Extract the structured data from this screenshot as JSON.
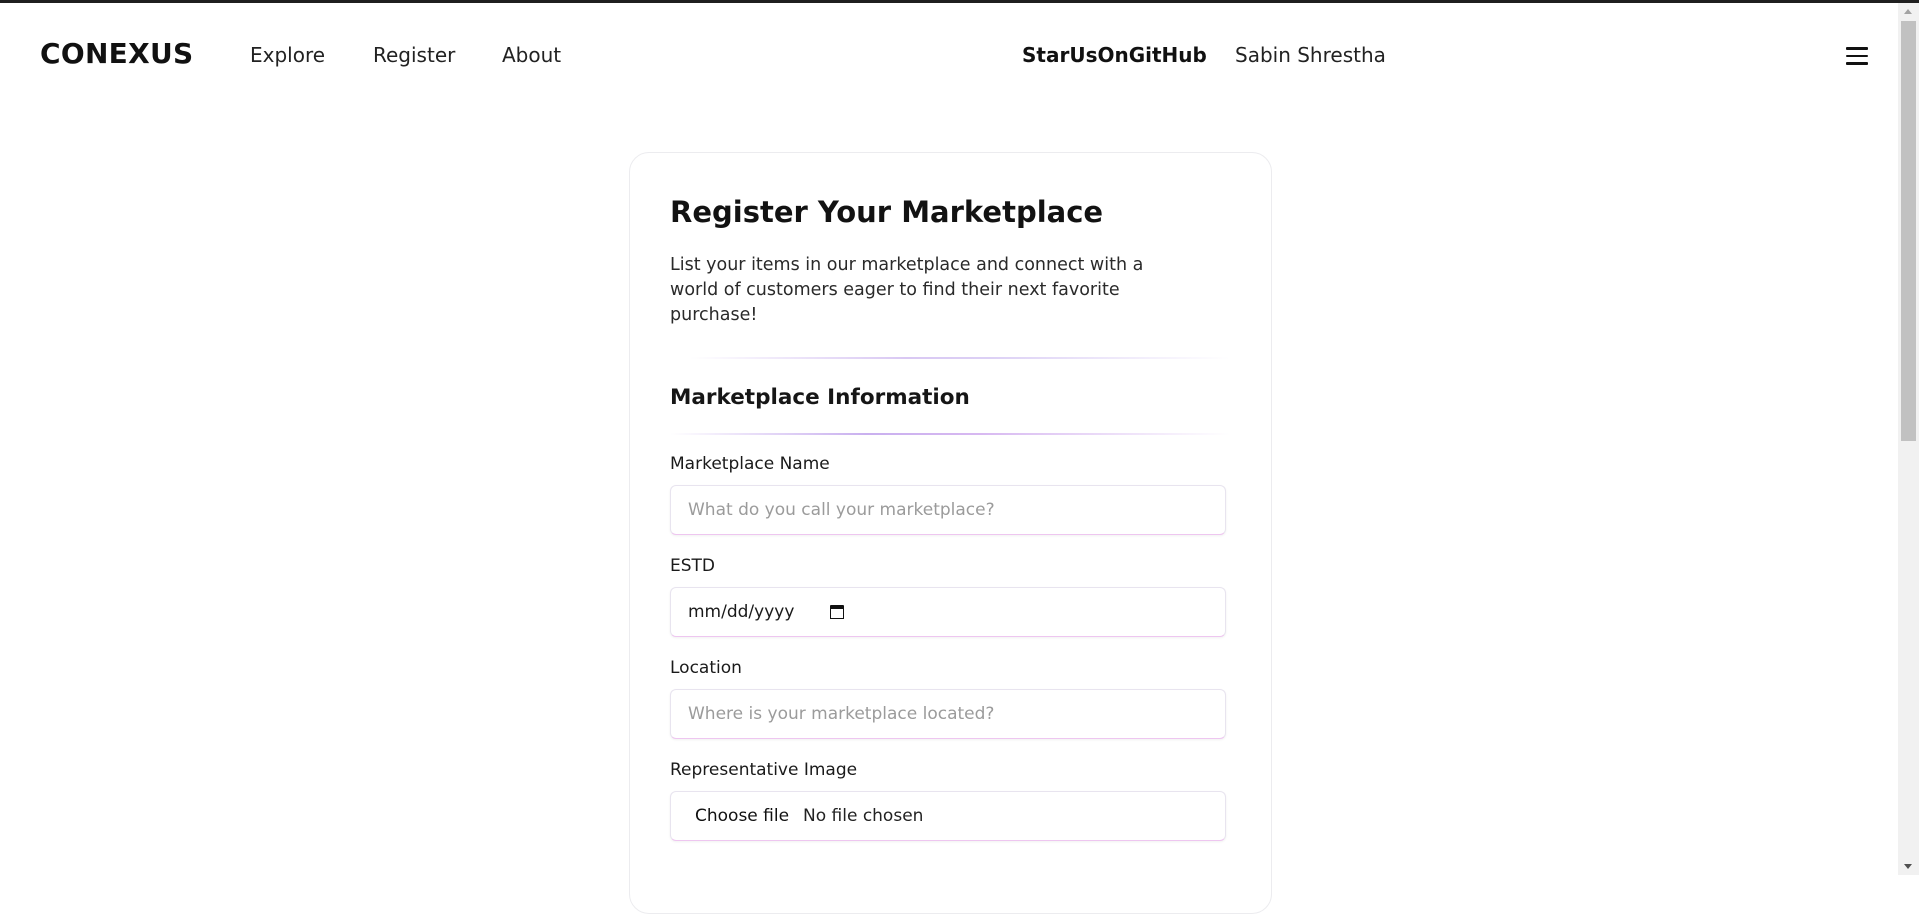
{
  "nav": {
    "brand": "CONEXUS",
    "links": [
      "Explore",
      "Register",
      "About"
    ],
    "github": "StarUsOnGitHub",
    "user": "Sabin Shrestha",
    "menu_icon": "hamburger-menu-icon"
  },
  "form": {
    "title": "Register Your Marketplace",
    "description": "List your items in our marketplace and connect with a world of customers eager to find their next favorite purchase!",
    "section_title": "Marketplace Information",
    "fields": {
      "name": {
        "label": "Marketplace Name",
        "placeholder": "What do you call your marketplace?"
      },
      "estd": {
        "label": "ESTD",
        "value": "mm/dd/yyyy"
      },
      "location": {
        "label": "Location",
        "placeholder": "Where is your marketplace located?"
      },
      "image": {
        "label": "Representative Image",
        "button": "Choose file",
        "status": "No file chosen"
      }
    }
  },
  "colors": {
    "text": "#111111",
    "divider_accent": "#c9b0ef",
    "input_border_accent": "#eec6f0"
  }
}
